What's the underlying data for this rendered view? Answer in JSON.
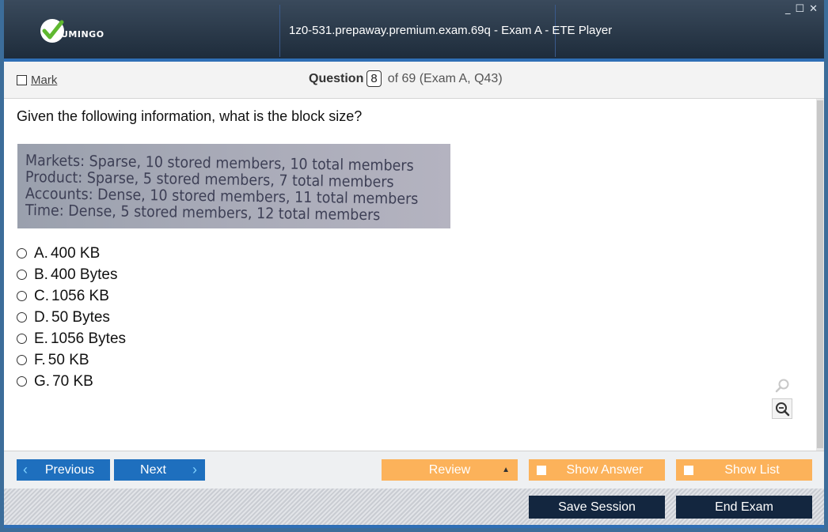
{
  "app": {
    "title": "1z0-531.prepaway.premium.exam.69q - Exam A - ETE Player",
    "logo_text": "UMINGO",
    "window_controls": [
      "_",
      "☐",
      "✕"
    ]
  },
  "question_bar": {
    "mark_label": "Mark",
    "question_label": "Question",
    "question_number": "8",
    "of_text": "of 69 (Exam A, Q43)"
  },
  "question": {
    "text": "Given the following information, what is the block size?",
    "exhibit_lines": [
      "Markets: Sparse, 10 stored members, 10 total members",
      "Product: Sparse, 5 stored members, 7 total members",
      "Accounts: Dense, 10 stored members, 11 total members",
      "Time: Dense, 5 stored members, 12 total members"
    ],
    "choices": [
      {
        "letter": "A.",
        "text": "400 KB"
      },
      {
        "letter": "B.",
        "text": "400 Bytes"
      },
      {
        "letter": "C.",
        "text": "1056 KB"
      },
      {
        "letter": "D.",
        "text": "50 Bytes"
      },
      {
        "letter": "E.",
        "text": "1056 Bytes"
      },
      {
        "letter": "F.",
        "text": "50 KB"
      },
      {
        "letter": "G.",
        "text": "70 KB"
      }
    ]
  },
  "zoom_icons": [
    "search-icon",
    "zoom-in-icon",
    "zoom-out-icon"
  ],
  "nav": {
    "previous_label": "Previous",
    "next_label": "Next",
    "review_label": "Review",
    "show_answer_label": "Show Answer",
    "show_list_label": "Show List",
    "save_session_label": "Save Session",
    "end_exam_label": "End Exam"
  },
  "colors": {
    "accent_blue": "#1e6fbe",
    "orange": "#fcb25a",
    "dark_button": "#13263f",
    "titlebar": "#1e2c3b"
  }
}
